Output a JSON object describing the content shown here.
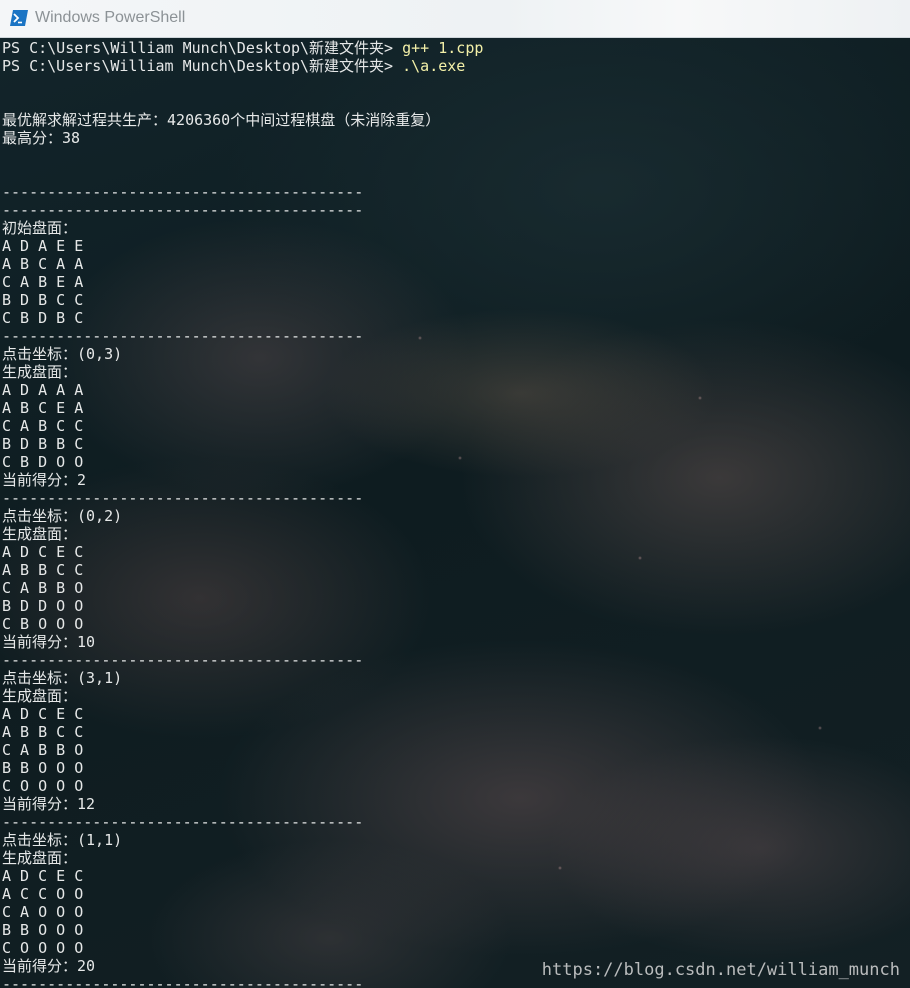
{
  "window": {
    "title": "Windows PowerShell",
    "icon": "powershell-icon",
    "accent": "#1b74c4"
  },
  "console": {
    "prompt_1": "PS C:\\Users\\William Munch\\Desktop\\新建文件夹> ",
    "command_1": "g++ 1.cpp",
    "prompt_2": "PS C:\\Users\\William Munch\\Desktop\\新建文件夹> ",
    "command_2": ".\\a.exe",
    "summary": "最优解求解过程共生产：4206360个中间过程棋盘（未消除重复）",
    "best_score": "最高分：38",
    "separator": "----------------------------------------",
    "initial_label": "初始盘面：",
    "initial_board": [
      "A D A E E",
      "A B C A A",
      "C A B E A",
      "B D B C C",
      "C B D B C"
    ],
    "steps": [
      {
        "click": "点击坐标：(0,3)",
        "gen_label": "生成盘面：",
        "board": [
          "A D A A A",
          "A B C E A",
          "C A B C C",
          "B D B B C",
          "C B D O O"
        ],
        "score": "当前得分：2"
      },
      {
        "click": "点击坐标：(0,2)",
        "gen_label": "生成盘面：",
        "board": [
          "A D C E C",
          "A B B C C",
          "C A B B O",
          "B D D O O",
          "C B O O O"
        ],
        "score": "当前得分：10"
      },
      {
        "click": "点击坐标：(3,1)",
        "gen_label": "生成盘面：",
        "board": [
          "A D C E C",
          "A B B C C",
          "C A B B O",
          "B B O O O",
          "C O O O O"
        ],
        "score": "当前得分：12"
      },
      {
        "click": "点击坐标：(1,1)",
        "gen_label": "生成盘面：",
        "board": [
          "A D C E C",
          "A C C O O",
          "C A O O O",
          "B B O O O",
          "C O O O O"
        ],
        "score": "当前得分：20"
      }
    ]
  },
  "watermark": "https://blog.csdn.net/william_munch"
}
